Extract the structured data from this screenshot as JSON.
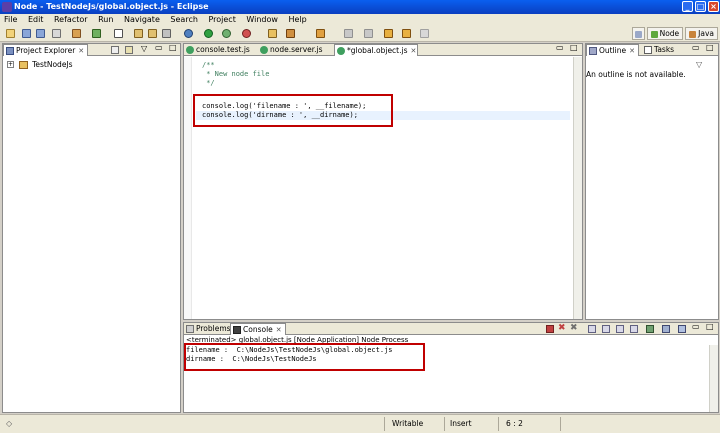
{
  "window": {
    "title": "Node - TestNodeJs/global.object.js - Eclipse"
  },
  "menu": [
    "File",
    "Edit",
    "Refactor",
    "Run",
    "Navigate",
    "Search",
    "Project",
    "Window",
    "Help"
  ],
  "perspectives": [
    {
      "label": "Node",
      "color": "#5fa83c"
    },
    {
      "label": "Java",
      "color": "#c8843c"
    }
  ],
  "explorer": {
    "tab_label": "Project Explorer",
    "tree": [
      {
        "label": "TestNodeJs",
        "toggle": "+"
      }
    ]
  },
  "editor": {
    "tabs": [
      {
        "label": "console.test.js",
        "active": false
      },
      {
        "label": "node.server.js",
        "active": false
      },
      {
        "label": "*global.object.js",
        "active": true
      }
    ],
    "lines": [
      {
        "text": "/**",
        "kind": "comment"
      },
      {
        "text": " * New node file",
        "kind": "comment"
      },
      {
        "text": " */",
        "kind": "comment"
      },
      {
        "text": "",
        "kind": "code"
      },
      {
        "text": "console.log('filename : ', __filename);",
        "kind": "code"
      },
      {
        "text": "console.log('dirname : ', __dirname);",
        "kind": "code"
      }
    ]
  },
  "outline": {
    "tabs": [
      {
        "label": "Outline",
        "active": true
      },
      {
        "label": "Tasks",
        "active": false
      }
    ],
    "message": "An outline is not available."
  },
  "console": {
    "tabs": [
      {
        "label": "Problems",
        "active": false
      },
      {
        "label": "Console",
        "active": true
      }
    ],
    "header": "<terminated> global.object.js [Node Application] Node Process",
    "output": [
      "filename :  C:\\NodeJs\\TestNodeJs\\global.object.js",
      "dirname :  C:\\NodeJs\\TestNodeJs"
    ]
  },
  "statusbar": {
    "mode": "Writable",
    "insert": "Insert",
    "position": "6 : 2"
  }
}
